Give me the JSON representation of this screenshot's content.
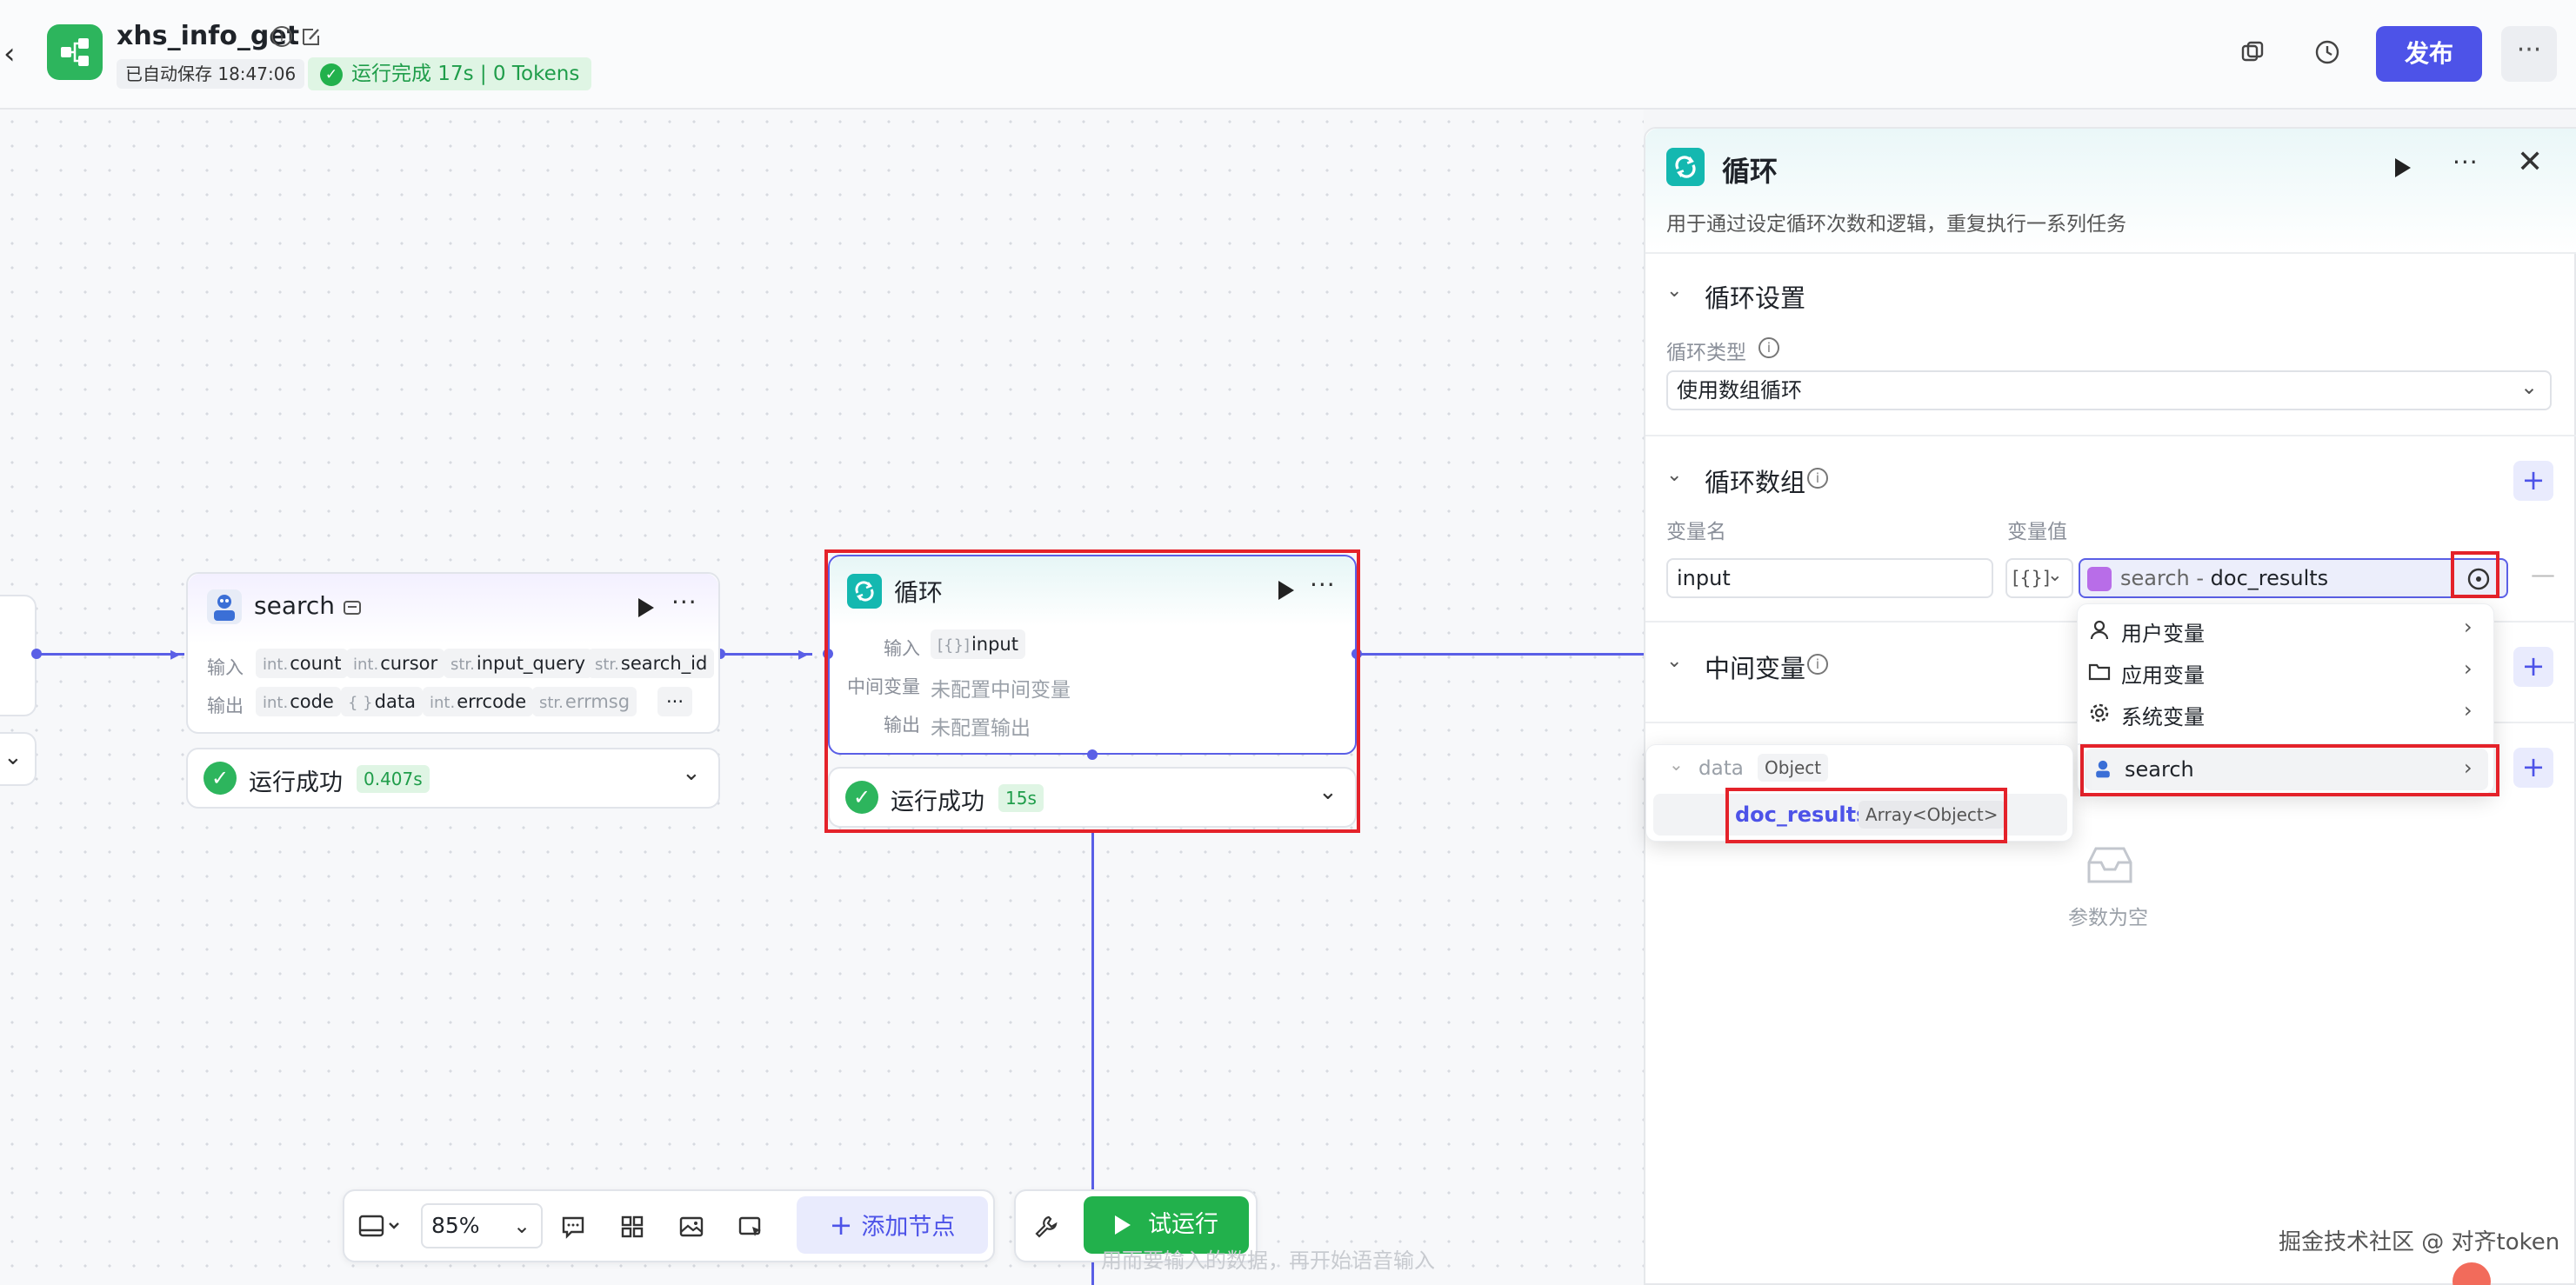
{
  "header": {
    "title": "xhs_info_get",
    "autosave": "已自动保存 18:47:06",
    "run_status": "运行完成 17s | 0 Tokens",
    "publish_label": "发布",
    "more_label": "···",
    "back_label": "‹"
  },
  "nodes": {
    "search": {
      "title": "search",
      "input_label": "输入",
      "output_label": "输出",
      "inputs": [
        {
          "type": "int.",
          "name": "count"
        },
        {
          "type": "int.",
          "name": "cursor"
        },
        {
          "type": "str.",
          "name": "input_query"
        },
        {
          "type": "str.",
          "name": "search_id"
        }
      ],
      "outputs": [
        {
          "type": "int.",
          "name": "code"
        },
        {
          "type": "{ }",
          "name": "data"
        },
        {
          "type": "int.",
          "name": "errcode"
        },
        {
          "type": "str.",
          "name": "errmsg"
        }
      ],
      "more_outputs": "···",
      "status": "运行成功",
      "time": "0.407s"
    },
    "loop": {
      "title": "循环",
      "input_label": "输入",
      "input_value": "input",
      "input_type": "[{}]",
      "mid_label": "中间变量",
      "mid_value": "未配置中间变量",
      "output_label": "输出",
      "output_value": "未配置输出",
      "status": "运行成功",
      "time": "15s"
    }
  },
  "toolbar": {
    "zoom": "85%",
    "add_node": "添加节点",
    "trial_run": "试运行",
    "faded_hint": "用而要输入的数据，再开始语音输入"
  },
  "panel": {
    "title": "循环",
    "description": "用于通过设定循环次数和逻辑，重复执行一系列任务",
    "loop_settings_title": "循环设置",
    "loop_type_label": "循环类型",
    "loop_type_value": "使用数组循环",
    "loop_array_title": "循环数组",
    "var_name_label": "变量名",
    "var_value_label": "变量值",
    "var_name_value": "input",
    "var_type": "[{}]",
    "var_ref_node": "search",
    "var_ref_sep": " - ",
    "var_ref_field": "doc_results",
    "mid_var_title": "中间变量",
    "empty_text": "参数为空"
  },
  "var_menu": {
    "items": [
      "用户变量",
      "应用变量",
      "系统变量",
      "search"
    ]
  },
  "sub_menu": {
    "parent_name": "data",
    "parent_type": "Object",
    "child_name": "doc_results",
    "child_type": "Array<Object>"
  },
  "watermark": "掘金技术社区 @ 对齐token",
  "colors": {
    "primary": "#4d53e8",
    "success": "#2db55d",
    "highlight_red": "#e4222a",
    "edge": "#5a5fe6"
  }
}
